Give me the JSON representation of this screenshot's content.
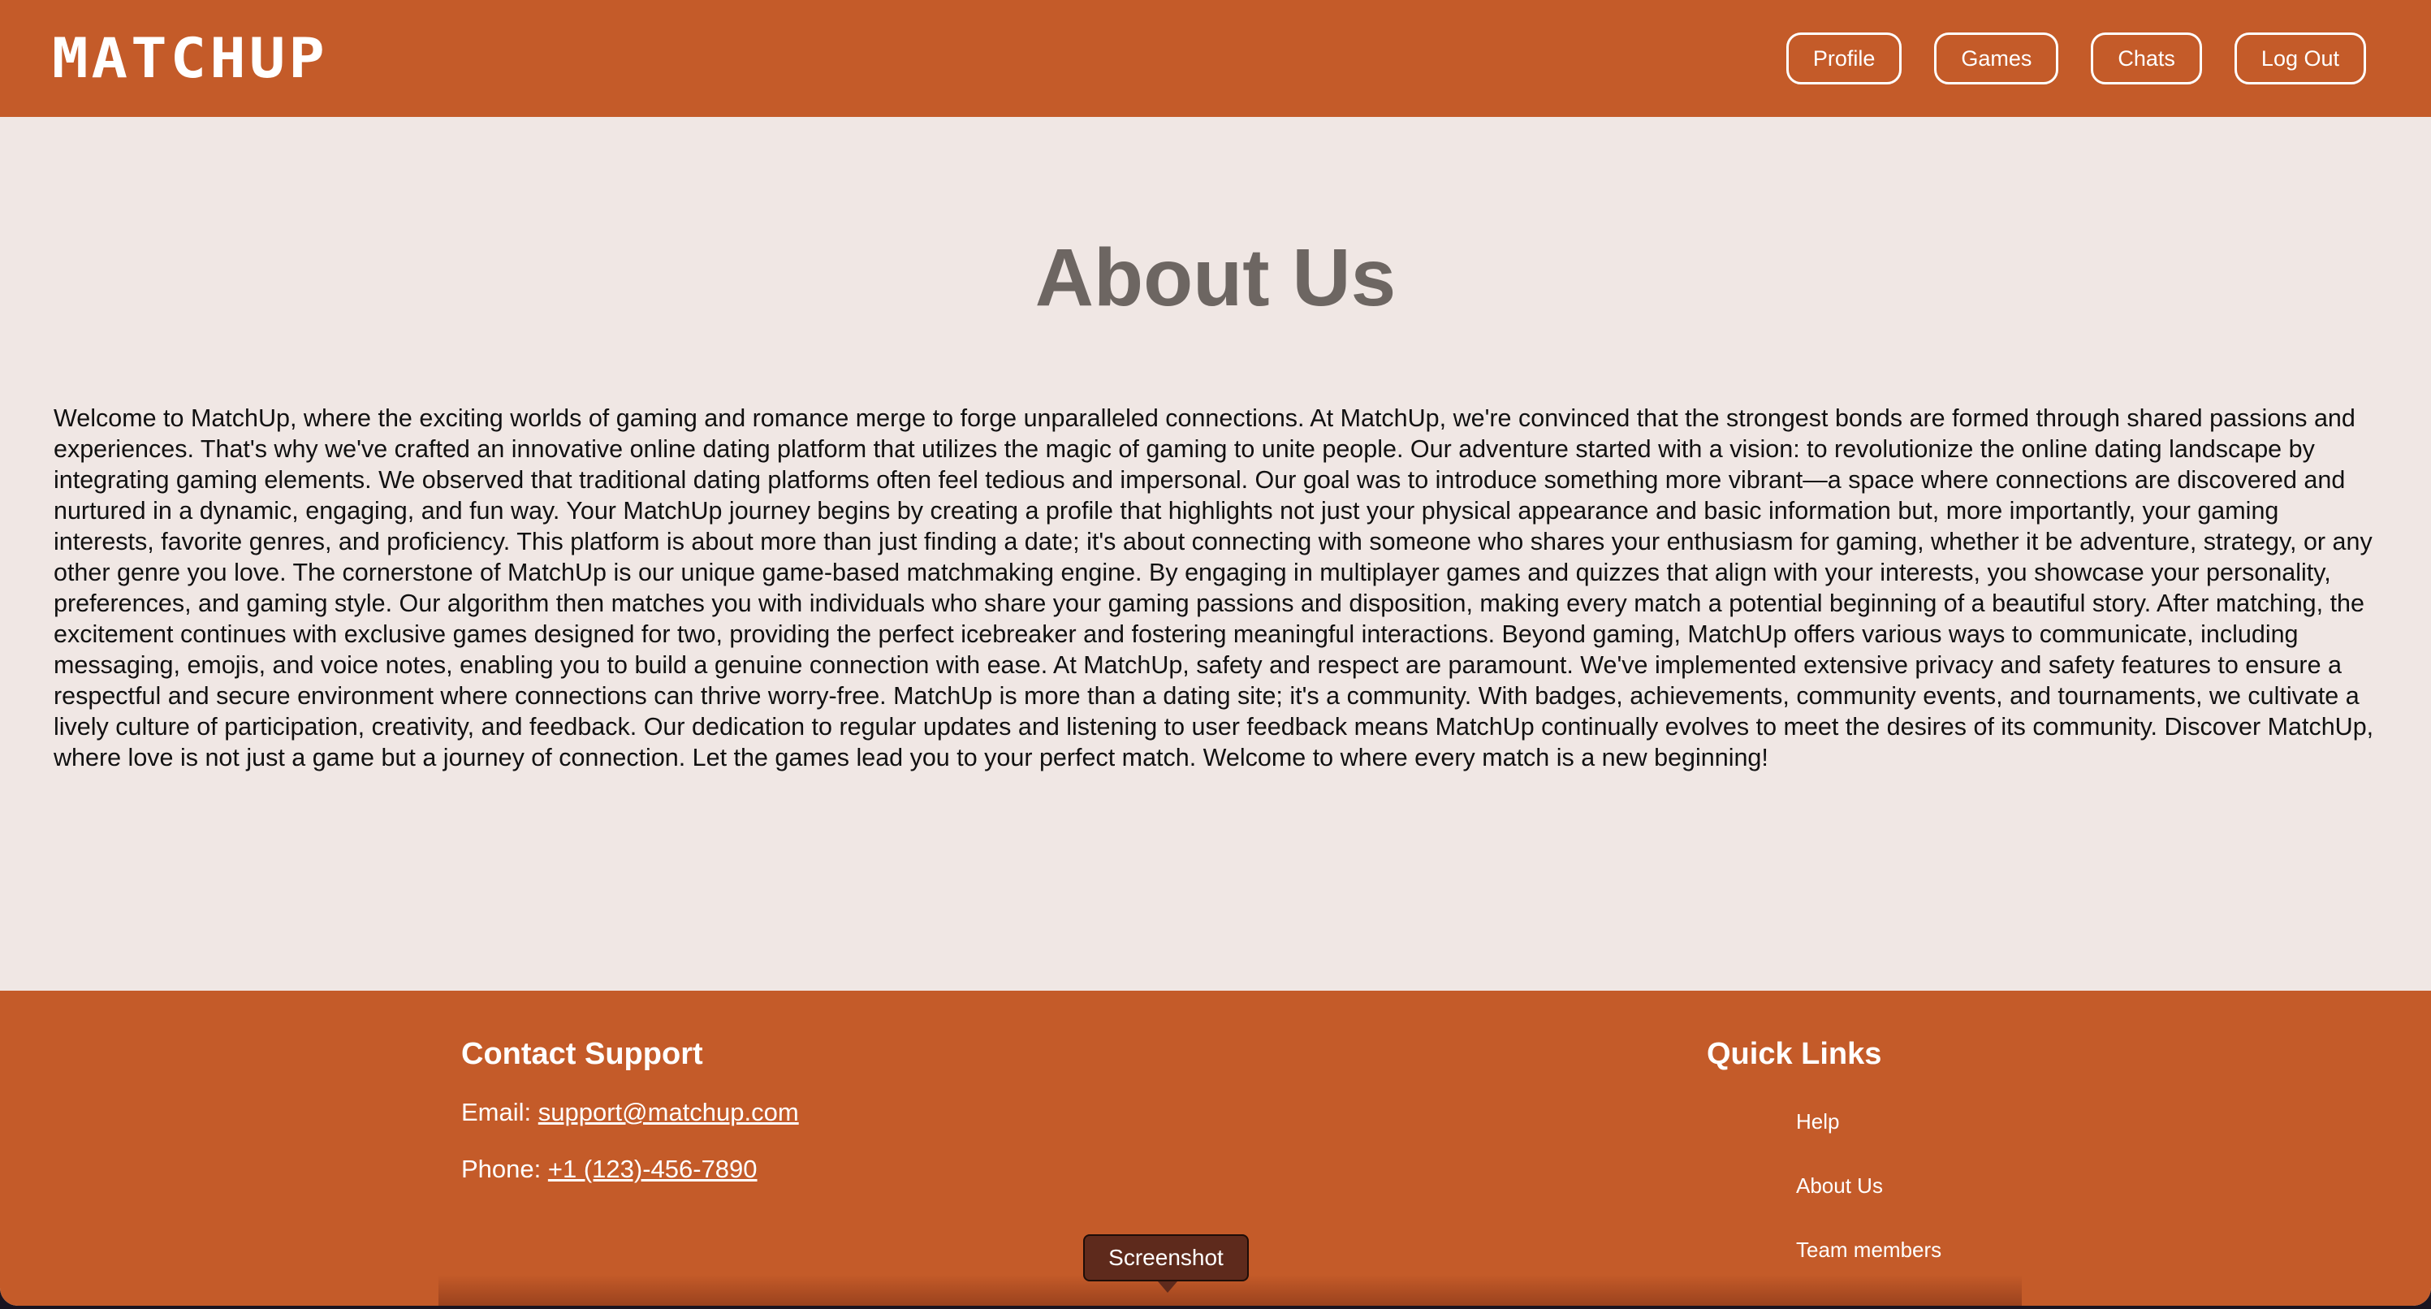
{
  "header": {
    "logo": "MATCHUP",
    "nav": {
      "profile": "Profile",
      "games": "Games",
      "chats": "Chats",
      "logout": "Log Out"
    }
  },
  "main": {
    "title": "About Us",
    "body": "Welcome to MatchUp, where the exciting worlds of gaming and romance merge to forge unparalleled connections. At MatchUp, we're convinced that the strongest bonds are formed through shared passions and experiences. That's why we've crafted an innovative online dating platform that utilizes the magic of gaming to unite people. Our adventure started with a vision: to revolutionize the online dating landscape by integrating gaming elements. We observed that traditional dating platforms often feel tedious and impersonal. Our goal was to introduce something more vibrant—a space where connections are discovered and nurtured in a dynamic, engaging, and fun way. Your MatchUp journey begins by creating a profile that highlights not just your physical appearance and basic information but, more importantly, your gaming interests, favorite genres, and proficiency. This platform is about more than just finding a date; it's about connecting with someone who shares your enthusiasm for gaming, whether it be adventure, strategy, or any other genre you love. The cornerstone of MatchUp is our unique game-based matchmaking engine. By engaging in multiplayer games and quizzes that align with your interests, you showcase your personality, preferences, and gaming style. Our algorithm then matches you with individuals who share your gaming passions and disposition, making every match a potential beginning of a beautiful story. After matching, the excitement continues with exclusive games designed for two, providing the perfect icebreaker and fostering meaningful interactions. Beyond gaming, MatchUp offers various ways to communicate, including messaging, emojis, and voice notes, enabling you to build a genuine connection with ease. At MatchUp, safety and respect are paramount. We've implemented extensive privacy and safety features to ensure a respectful and secure environment where connections can thrive worry-free. MatchUp is more than a dating site; it's a community. With badges, achievements, community events, and tournaments, we cultivate a lively culture of participation, creativity, and feedback. Our dedication to regular updates and listening to user feedback means MatchUp continually evolves to meet the desires of its community. Discover MatchUp, where love is not just a game but a journey of connection. Let the games lead you to your perfect match. Welcome to where every match is a new beginning!"
  },
  "footer": {
    "contact": {
      "title": "Contact Support",
      "email_label": "Email: ",
      "email": "support@matchup.com",
      "phone_label": "Phone: ",
      "phone": "+1 (123)-456-7890"
    },
    "quick_links": {
      "title": "Quick Links",
      "items": [
        "Help",
        "About Us",
        "Team members"
      ]
    }
  },
  "overlay": {
    "tooltip": "Screenshot"
  },
  "colors": {
    "brand": "#c45b29",
    "background": "#f0e7e4",
    "title": "#6d6662"
  }
}
